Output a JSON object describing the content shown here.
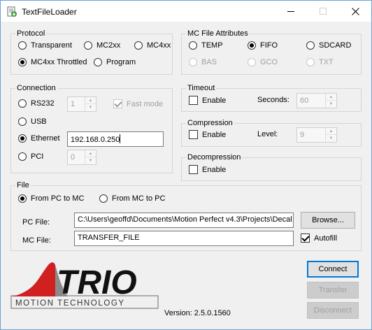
{
  "window": {
    "title": "TextFileLoader"
  },
  "protocol": {
    "legend": "Protocol",
    "options": [
      "Transparent",
      "MC2xx",
      "MC4xx",
      "MC4xx Throttled",
      "Program"
    ],
    "selected": "MC4xx Throttled"
  },
  "mc_file_attributes": {
    "legend": "MC File Attributes",
    "options": [
      "TEMP",
      "FIFO",
      "SDCARD",
      "BAS",
      "GCO",
      "TXT"
    ],
    "selected": "FIFO"
  },
  "connection": {
    "legend": "Connection",
    "rs232_label": "RS232",
    "rs232_port": "1",
    "fast_mode_label": "Fast mode",
    "usb_label": "USB",
    "ethernet_label": "Ethernet",
    "ethernet_address": "192.168.0.250",
    "pci_label": "PCI",
    "pci_value": "0",
    "selected": "Ethernet"
  },
  "timeout": {
    "legend": "Timeout",
    "enable_label": "Enable",
    "seconds_label": "Seconds:",
    "seconds_value": "60"
  },
  "compression": {
    "legend": "Compression",
    "enable_label": "Enable",
    "level_label": "Level:",
    "level_value": "9"
  },
  "decompression": {
    "legend": "Decompression",
    "enable_label": "Enable"
  },
  "file": {
    "legend": "File",
    "direction_options": [
      "From PC to MC",
      "From MC to PC"
    ],
    "selected_direction": "From PC to MC",
    "pc_file_label": "PC File:",
    "pc_file_value": "C:\\Users\\geoffd\\Documents\\Motion Perfect v4.3\\Projects\\Decal",
    "browse_label": "Browse...",
    "mc_file_label": "MC File:",
    "mc_file_value": "TRANSFER_FILE",
    "autofill_label": "Autofill",
    "autofill_checked": true
  },
  "logo": {
    "brand": "TRIO",
    "tagline": "MOTION TECHNOLOGY"
  },
  "version_text": "Version: 2.5.0.1560",
  "buttons": {
    "connect": "Connect",
    "transfer": "Transfer",
    "disconnect": "Disconnect"
  }
}
